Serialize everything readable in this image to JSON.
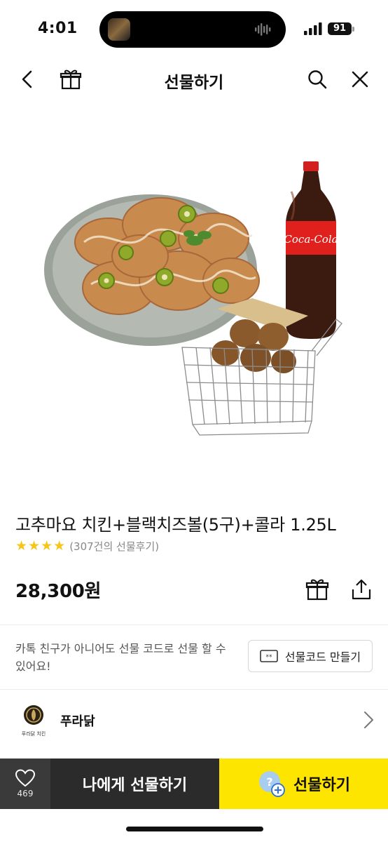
{
  "status_bar": {
    "time": "4:01",
    "battery": "91"
  },
  "nav": {
    "title": "선물하기",
    "icons": [
      "back-chevron-icon",
      "gift-box-icon",
      "search-icon",
      "close-icon"
    ]
  },
  "product": {
    "title": "고추마요 치킨+블랙치즈볼(5구)+콜라 1.25L",
    "rating_stars": 4,
    "review_count": "(307건의 선물후기)",
    "price": "28,300원",
    "image_label": "Coca-Cola"
  },
  "gift_code": {
    "description": "카톡 친구가 아니어도 선물 코드로 선물 할 수 있어요!",
    "button_label": "선물코드 만들기"
  },
  "brand": {
    "name": "푸라닭",
    "logo_text": "푸라닭 치킨"
  },
  "bottom_bar": {
    "like_count": "469",
    "self_gift_label": "나에게 선물하기",
    "gift_label": "선물하기"
  },
  "colors": {
    "accent_yellow": "#fee500",
    "dark_button": "#2b2b2b",
    "like_bg": "#3a3a3a",
    "star": "#f5c518"
  }
}
